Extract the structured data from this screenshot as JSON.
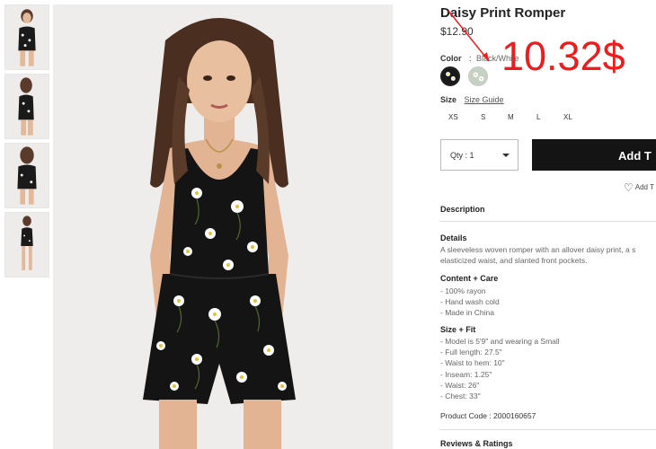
{
  "product": {
    "title": "Daisy Print Romper",
    "price": "$12.90",
    "price_annotation": "10.32$"
  },
  "color": {
    "label": "Color",
    "separator": ":",
    "value": "Black/White",
    "swatches": [
      "black-white-daisy",
      "sage-daisy"
    ]
  },
  "size": {
    "label": "Size",
    "guide_link": "Size Guide",
    "options": [
      "XS",
      "S",
      "M",
      "L",
      "XL"
    ]
  },
  "purchase": {
    "qty_label": "Qty : 1",
    "add_button": "Add T",
    "wishlist": "Add T"
  },
  "description": {
    "title": "Description"
  },
  "details": {
    "title": "Details",
    "lines": [
      "A sleeveless woven romper with an allover daisy print, a s",
      "elasticized waist, and slanted front pockets."
    ]
  },
  "content_care": {
    "title": "Content + Care",
    "items": [
      "- 100% rayon",
      "- Hand wash cold",
      "- Made in China"
    ]
  },
  "size_fit": {
    "title": "Size + Fit",
    "items": [
      "- Model is 5'9\" and wearing a Small",
      "- Full length: 27.5\"",
      "- Waist to hem: 10\"",
      "- Inseam: 1.25\"",
      "- Waist: 26\"",
      "- Chest: 33\""
    ]
  },
  "product_code": "Product Code : 2000160657",
  "reviews": {
    "title": "Reviews & Ratings"
  },
  "colors": {
    "annotation_red": "#ee1c1c",
    "button_black": "#141414"
  }
}
